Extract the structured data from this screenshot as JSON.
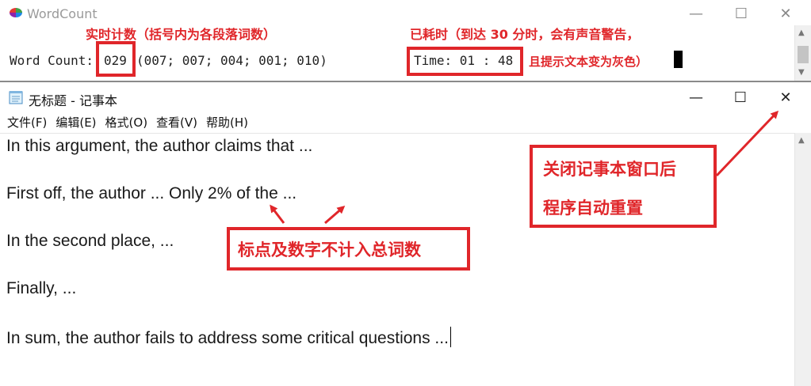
{
  "wordcount_window": {
    "title": "WordCount",
    "controls": {
      "minimize": "—",
      "maximize": "☐",
      "close": "✕"
    },
    "word_count_label": "Word Count:",
    "word_count_value": "029",
    "paragraph_counts": "(007; 007; 004; 001; 010)",
    "time_text": "Time: 01 : 48",
    "annotations": {
      "count_note": "实时计数（括号内为各段落词数）",
      "time_note_line1": "已耗时（到达 30 分时，会有声音警告，",
      "time_note_line2": "且提示文本变为灰色）"
    }
  },
  "notepad_window": {
    "title": "无标题 - 记事本",
    "controls": {
      "minimize": "—",
      "maximize": "☐",
      "close": "✕"
    },
    "menu": [
      "文件(F)",
      "编辑(E)",
      "格式(O)",
      "查看(V)",
      "帮助(H)"
    ],
    "lines": [
      "In this argument, the author claims that ...",
      "First off, the author ... Only 2% of the ...",
      "In the second place, ...",
      "Finally, ...",
      "In sum, the author fails to address some critical questions ..."
    ],
    "annotations": {
      "punctuation_note": "标点及数字不计入总词数",
      "reset_note_line1": "关闭记事本窗口后",
      "reset_note_line2": "程序自动重置"
    }
  },
  "colors": {
    "annotation_red": "#e0262a"
  }
}
